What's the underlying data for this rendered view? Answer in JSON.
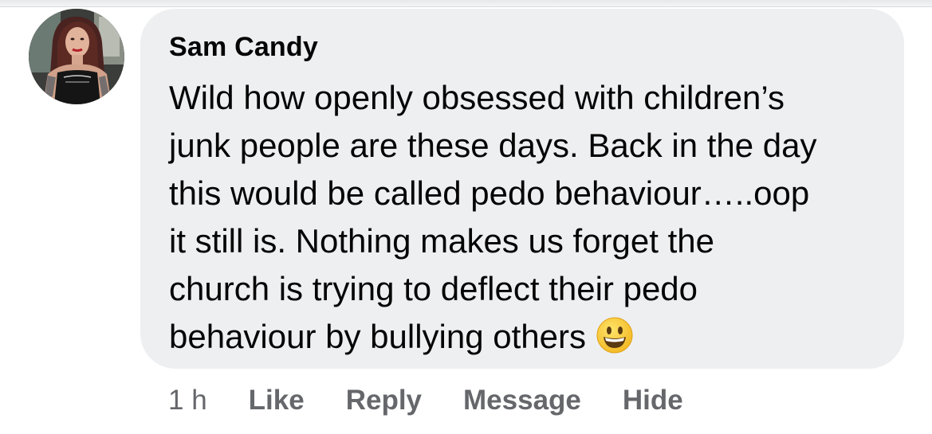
{
  "comment": {
    "author_name": "Sam Candy",
    "text_lines": [
      "Wild how openly obsessed with children’s",
      "junk people are these days. Back in the day",
      "this would be called pedo behaviour…..oop",
      "it still is. Nothing makes us forget the",
      "church is trying to deflect their pedo",
      "behaviour by bullying others"
    ],
    "emoji": "grinning-face-emoji",
    "timestamp": "1 h",
    "actions": {
      "like_label": "Like",
      "reply_label": "Reply",
      "message_label": "Message",
      "hide_label": "Hide"
    }
  },
  "colors": {
    "bubble_background": "#eeeff1",
    "text_primary": "#050505",
    "text_secondary": "#65676b",
    "emoji_yellow": "#f7c62f"
  }
}
